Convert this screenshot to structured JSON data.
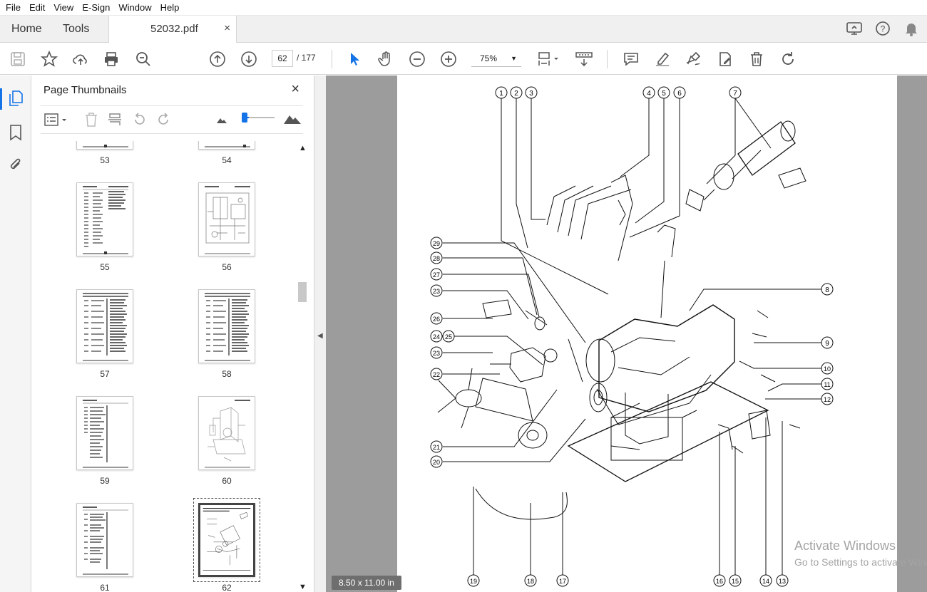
{
  "menu": [
    "File",
    "Edit",
    "View",
    "E-Sign",
    "Window",
    "Help"
  ],
  "tabs": {
    "home": "Home",
    "tools": "Tools",
    "document": "52032.pdf",
    "close": "×"
  },
  "toolbar": {
    "current_page": "62",
    "total_pages": "/  177",
    "zoom": "75%"
  },
  "panel": {
    "title": "Page Thumbnails",
    "close": "×",
    "thumbnails": [
      {
        "label": "53"
      },
      {
        "label": "54"
      },
      {
        "label": "55"
      },
      {
        "label": "56"
      },
      {
        "label": "57"
      },
      {
        "label": "58"
      },
      {
        "label": "59"
      },
      {
        "label": "60"
      },
      {
        "label": "61"
      },
      {
        "label": "62"
      }
    ]
  },
  "document": {
    "page_size": "8.50 x 11.00 in",
    "callouts": [
      "1",
      "2",
      "3",
      "4",
      "5",
      "6",
      "7",
      "8",
      "9",
      "10",
      "11",
      "12",
      "13",
      "14",
      "15",
      "16",
      "17",
      "18",
      "19",
      "20",
      "21",
      "22",
      "23",
      "24",
      "25",
      "26",
      "27",
      "28",
      "29"
    ],
    "callout_pair": "24 25",
    "callout_23_b": "23"
  },
  "watermark": {
    "line1": "Activate Windows",
    "line2": "Go to Settings to activate Windows."
  },
  "colors": {
    "accent": "#1473e6",
    "doc_background": "#9c9c9c"
  }
}
